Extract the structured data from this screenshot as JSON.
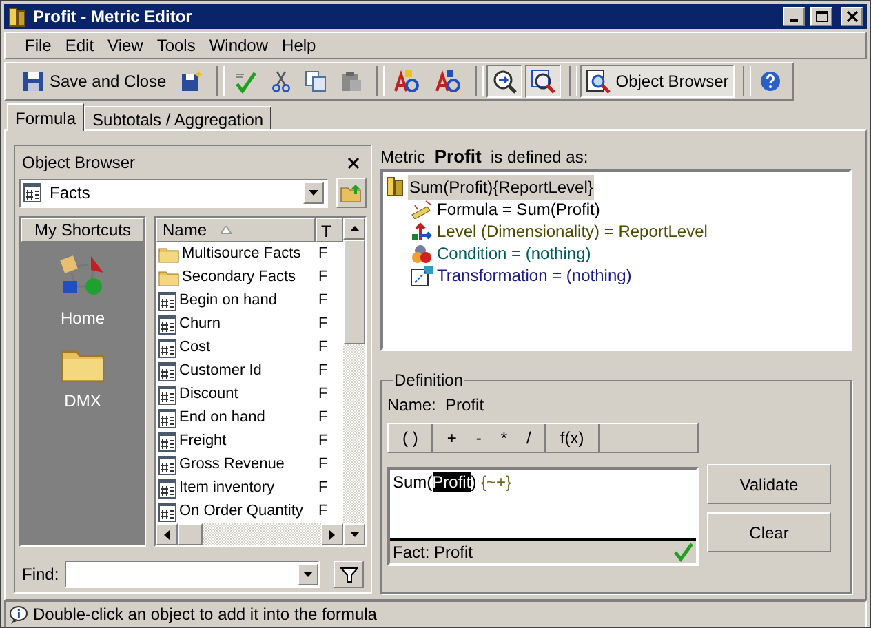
{
  "window": {
    "title": "Profit - Metric Editor"
  },
  "menu": [
    "File",
    "Edit",
    "View",
    "Tools",
    "Window",
    "Help"
  ],
  "toolbar": [
    {
      "kind": "save",
      "label": "Save and Close",
      "pressed": false
    },
    {
      "kind": "save-new",
      "pressed": false
    },
    {
      "kind": "sep"
    },
    {
      "kind": "sum-check",
      "pressed": false
    },
    {
      "kind": "cut",
      "pressed": false
    },
    {
      "kind": "copy",
      "pressed": false
    },
    {
      "kind": "paste",
      "pressed": false
    },
    {
      "kind": "sep"
    },
    {
      "kind": "abc",
      "pressed": false
    },
    {
      "kind": "abc2",
      "pressed": false
    },
    {
      "kind": "sep"
    },
    {
      "kind": "zoom-arrow",
      "pressed": true
    },
    {
      "kind": "zoom-box",
      "pressed": true
    },
    {
      "kind": "sep"
    },
    {
      "kind": "browser",
      "label": "Object Browser",
      "pressed": true
    },
    {
      "kind": "sep"
    },
    {
      "kind": "help",
      "pressed": false
    }
  ],
  "tabs": [
    {
      "label": "Formula",
      "selected": true
    },
    {
      "label": "Subtotals / Aggregation",
      "selected": false
    }
  ],
  "object_browser": {
    "title": "Object Browser",
    "folder": "Facts",
    "shortcuts": {
      "title": "My Shortcuts",
      "items": [
        {
          "kind": "home",
          "label": "Home"
        },
        {
          "kind": "folder",
          "label": "DMX"
        }
      ]
    },
    "columns": [
      "Name",
      "T"
    ],
    "rows": [
      {
        "kind": "folder",
        "name": "Multisource Facts",
        "column_2": "F"
      },
      {
        "kind": "folder",
        "name": "Secondary Facts",
        "column_2": "F"
      },
      {
        "kind": "fact",
        "name": "Begin on hand",
        "column_2": "F"
      },
      {
        "kind": "fact",
        "name": "Churn",
        "column_2": "F"
      },
      {
        "kind": "fact",
        "name": "Cost",
        "column_2": "F"
      },
      {
        "kind": "fact",
        "name": "Customer Id",
        "column_2": "F"
      },
      {
        "kind": "fact",
        "name": "Discount",
        "column_2": "F"
      },
      {
        "kind": "fact",
        "name": "End on hand",
        "column_2": "F"
      },
      {
        "kind": "fact",
        "name": "Freight",
        "column_2": "F"
      },
      {
        "kind": "fact",
        "name": "Gross Revenue",
        "column_2": "F"
      },
      {
        "kind": "fact",
        "name": "Item inventory",
        "column_2": "F"
      },
      {
        "kind": "fact",
        "name": "On Order Quantity",
        "column_2": "F"
      }
    ],
    "find": {
      "label": "Find:"
    }
  },
  "metric": {
    "prefix": "Metric",
    "name": "Profit",
    "suffix": "is defined as:",
    "tree": {
      "label": "Sum(Profit){ReportLevel}",
      "selected": true,
      "children": [
        {
          "kind": "formula",
          "label": "Formula = Sum(Profit)",
          "color": "#000000"
        },
        {
          "kind": "level",
          "label": "Level (Dimensionality) = ReportLevel",
          "color": "#4a4a00"
        },
        {
          "kind": "condition",
          "label": "Condition = (nothing)",
          "color": "#005a5a"
        },
        {
          "kind": "transformation",
          "label": "Transformation = (nothing)",
          "color": "#1a1a80"
        }
      ]
    }
  },
  "definition": {
    "title": "Definition",
    "name_label": "Name:",
    "name": "Profit",
    "operators": [
      [
        "( )"
      ],
      [
        "+",
        "-",
        "*",
        "/"
      ],
      [
        "f(x)"
      ]
    ],
    "formula": [
      {
        "kind": "plain",
        "text": "Sum("
      },
      {
        "kind": "selected",
        "text": "Profit"
      },
      {
        "kind": "plain",
        "text": ") "
      },
      {
        "kind": "token",
        "text": "{~+}"
      }
    ],
    "status": "Fact: Profit",
    "valid": true,
    "buttons": [
      "Validate",
      "Clear"
    ]
  },
  "status_bar": "Double-click an object to add it into the formula"
}
